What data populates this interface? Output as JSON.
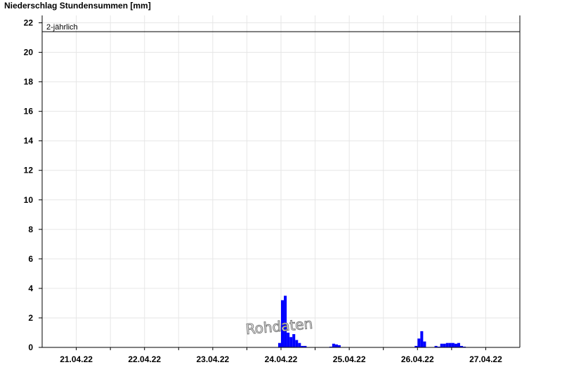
{
  "chart_data": {
    "type": "bar",
    "title": "Niederschlag Stundensummen [mm]",
    "x_axis": {
      "type": "time",
      "start": "2022-04-20T12:00",
      "end": "2022-04-27T12:00",
      "tick_labels": [
        "21.04.22",
        "22.04.22",
        "23.04.22",
        "24.04.22",
        "25.04.22",
        "26.04.22",
        "27.04.22"
      ]
    },
    "y_axis": {
      "ylim": [
        0,
        22.5
      ],
      "ticks": [
        0,
        2,
        4,
        6,
        8,
        10,
        12,
        14,
        16,
        18,
        20,
        22
      ]
    },
    "grid": true,
    "bar_color": "#0000ff",
    "reference_line": {
      "label": "2-jährlich",
      "value": 21.4
    },
    "watermark": "Rohdaten",
    "series": [
      {
        "values": [
          {
            "t": "2022-04-23T23:00",
            "v": 0.3
          },
          {
            "t": "2022-04-24T00:00",
            "v": 3.2
          },
          {
            "t": "2022-04-24T01:00",
            "v": 3.5
          },
          {
            "t": "2022-04-24T02:00",
            "v": 1.0
          },
          {
            "t": "2022-04-24T03:00",
            "v": 0.7
          },
          {
            "t": "2022-04-24T04:00",
            "v": 0.9
          },
          {
            "t": "2022-04-24T05:00",
            "v": 0.5
          },
          {
            "t": "2022-04-24T06:00",
            "v": 0.3
          },
          {
            "t": "2022-04-24T07:00",
            "v": 0.1
          },
          {
            "t": "2022-04-24T08:00",
            "v": 0.1
          },
          {
            "t": "2022-04-24T17:00",
            "v": 0.05
          },
          {
            "t": "2022-04-24T18:00",
            "v": 0.25
          },
          {
            "t": "2022-04-24T19:00",
            "v": 0.2
          },
          {
            "t": "2022-04-24T20:00",
            "v": 0.15
          },
          {
            "t": "2022-04-25T23:00",
            "v": 0.1
          },
          {
            "t": "2022-04-26T00:00",
            "v": 0.6
          },
          {
            "t": "2022-04-26T01:00",
            "v": 1.1
          },
          {
            "t": "2022-04-26T02:00",
            "v": 0.4
          },
          {
            "t": "2022-04-26T06:00",
            "v": 0.1
          },
          {
            "t": "2022-04-26T07:00",
            "v": 0.05
          },
          {
            "t": "2022-04-26T08:00",
            "v": 0.25
          },
          {
            "t": "2022-04-26T09:00",
            "v": 0.25
          },
          {
            "t": "2022-04-26T10:00",
            "v": 0.3
          },
          {
            "t": "2022-04-26T11:00",
            "v": 0.3
          },
          {
            "t": "2022-04-26T12:00",
            "v": 0.3
          },
          {
            "t": "2022-04-26T13:00",
            "v": 0.25
          },
          {
            "t": "2022-04-26T14:00",
            "v": 0.3
          },
          {
            "t": "2022-04-26T15:00",
            "v": 0.1
          },
          {
            "t": "2022-04-26T16:00",
            "v": 0.05
          }
        ]
      }
    ]
  }
}
